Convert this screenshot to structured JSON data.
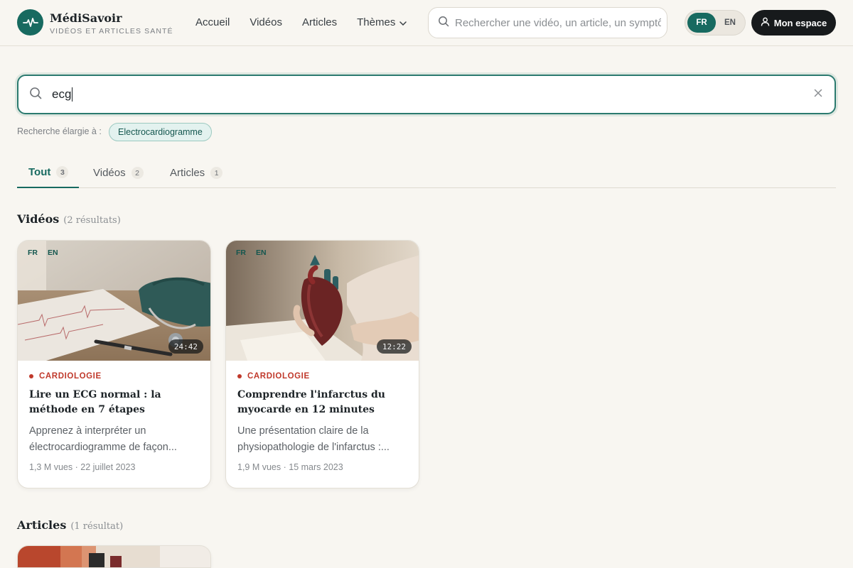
{
  "header": {
    "brand_name": "MédiSavoir",
    "brand_tagline": "VIDÉOS ET ARTICLES SANTÉ",
    "nav": [
      {
        "label": "Accueil"
      },
      {
        "label": "Vidéos"
      },
      {
        "label": "Articles"
      },
      {
        "label": "Thèmes"
      }
    ],
    "search_placeholder": "Rechercher une vidéo, un article, un symptôme",
    "lang_fr": "FR",
    "lang_en": "EN",
    "account_label": "Mon espace"
  },
  "search": {
    "query": "ecg",
    "expanded_label": "Recherche élargie à :",
    "expanded_term": "Electrocardiogramme"
  },
  "tabs": [
    {
      "label": "Tout",
      "count": "3",
      "active": true
    },
    {
      "label": "Vidéos",
      "count": "2",
      "active": false
    },
    {
      "label": "Articles",
      "count": "1",
      "active": false
    }
  ],
  "sections": {
    "videos": {
      "title": "Vidéos",
      "count": "(2 résultats)"
    },
    "articles": {
      "title": "Articles",
      "count": "(1 résultat)"
    }
  },
  "videos": [
    {
      "langs": [
        "FR",
        "EN"
      ],
      "duration": "24:42",
      "category": "CARDIOLOGIE",
      "title": "Lire un ECG normal : la méthode en 7 étapes",
      "description": "Apprenez à interpréter un électrocardiogramme de façon...",
      "meta": "1,3 M vues · 22 juillet 2023"
    },
    {
      "langs": [
        "FR",
        "EN"
      ],
      "duration": "12:22",
      "category": "CARDIOLOGIE",
      "title": "Comprendre l'infarctus du myocarde en 12 minutes",
      "description": "Une présentation claire de la physiopathologie de l'infarctus :...",
      "meta": "1,9 M vues · 15 mars 2023"
    }
  ],
  "colors": {
    "brand": "#176a60",
    "category": "#c0392b",
    "background": "#f8f6f1"
  }
}
